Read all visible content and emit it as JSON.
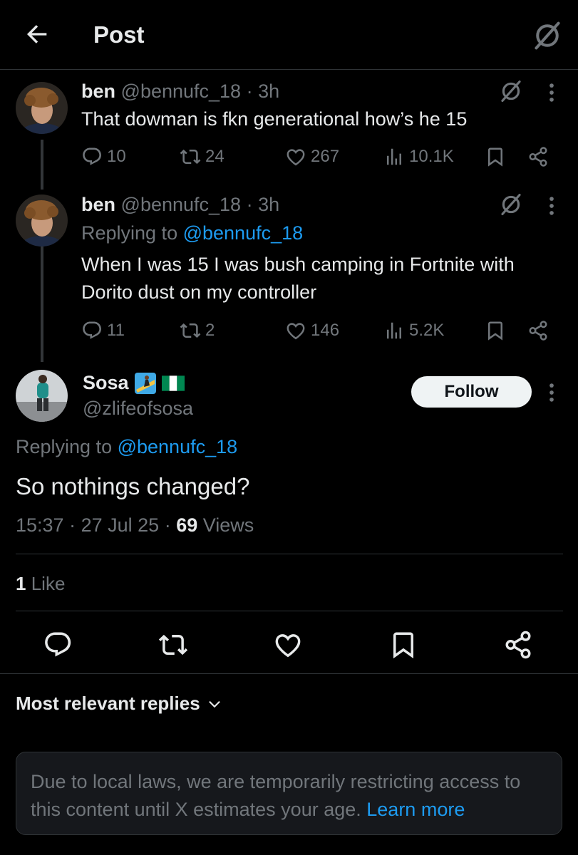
{
  "header": {
    "title": "Post"
  },
  "thread": [
    {
      "name": "ben",
      "handle": "@bennufc_18",
      "time": "· 3h",
      "replying_prefix": "",
      "replying_handle": "",
      "text": "That dowman is fkn generational how’s he 15",
      "stats": {
        "replies": "10",
        "reposts": "24",
        "likes": "267",
        "views": "10.1K"
      }
    },
    {
      "name": "ben",
      "handle": "@bennufc_18",
      "time": "· 3h",
      "replying_prefix": "Replying to ",
      "replying_handle": "@bennufc_18",
      "text": "When I was 15 I was bush camping in Fortnite with Dorito dust on my controller",
      "stats": {
        "replies": "11",
        "reposts": "2",
        "likes": "146",
        "views": "5.2K"
      }
    }
  ],
  "main_post": {
    "name": "Sosa",
    "handle": "@zlifeofsosa",
    "follow_label": "Follow",
    "replying_prefix": "Replying to ",
    "replying_handle": "@bennufc_18",
    "text": "So nothings changed?",
    "time": "15:37",
    "date": "27 Jul 25",
    "views_count": "69",
    "views_label": "Views",
    "likes_count": "1",
    "likes_label": "Like"
  },
  "replies": {
    "sort_label": "Most relevant replies",
    "notice_text": "Due to local laws, we are temporarily restricting access to this content until X estimates your age.",
    "notice_link": "Learn more"
  },
  "icons": {
    "back": "arrow-left-icon",
    "grok": "grok-icon",
    "more": "more-vertical-icon",
    "reply": "reply-icon",
    "repost": "repost-icon",
    "like": "heart-icon",
    "views": "views-icon",
    "bookmark": "bookmark-icon",
    "share": "share-icon",
    "chevron": "chevron-down-icon"
  },
  "colors": {
    "background": "#000000",
    "text": "#e7e9ea",
    "muted": "#71767b",
    "link": "#1d9bf0",
    "border": "#2f3336"
  }
}
